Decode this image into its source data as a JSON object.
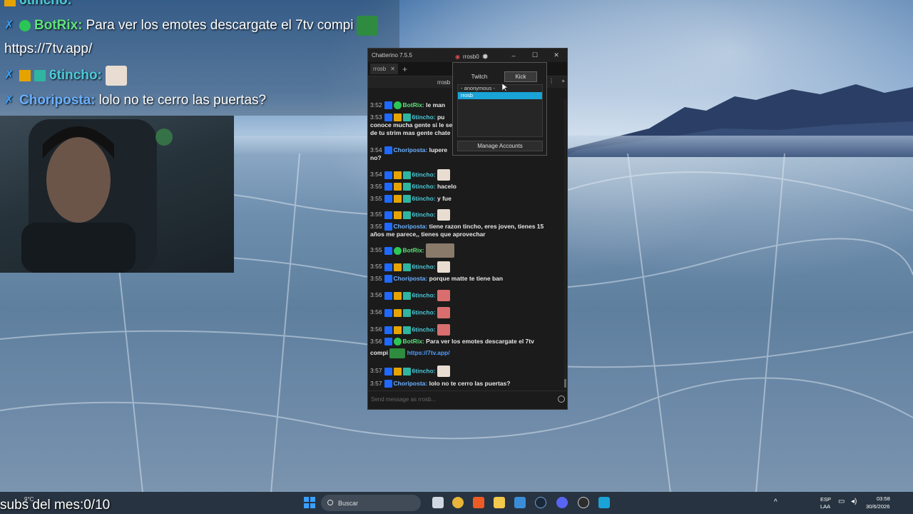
{
  "overlay_chat": {
    "top_partial_user": "6tincho:",
    "lines": [
      {
        "user": "BotRix:",
        "text": "Para ver los emotes descargate el 7tv compi"
      },
      {
        "user": "",
        "text": "https://7tv.app/"
      },
      {
        "user": "6tincho:",
        "text": ""
      },
      {
        "user": "Choriposta:",
        "text": "lolo no te cerro las puertas?"
      }
    ]
  },
  "subs_counter": "subs del mes:0/10",
  "chatterino": {
    "app_title": "Chatterino 7.5.5",
    "current_user": "rrosb0",
    "tab_label": "rrosb",
    "split_name": "rrosb",
    "input_placeholder": "Send message as rrosb...",
    "messages": [
      {
        "time": "3:52",
        "user": "BotRix:",
        "text": "le man"
      },
      {
        "time": "3:53",
        "user": "6tincho:",
        "text": "pu",
        "wrap": "conoce mucha gente si le se",
        "wrap2": "de tu strim mas gente chate"
      },
      {
        "time": "3:54",
        "user": "Choriposta:",
        "text": "lupere",
        "wrap": "no?"
      },
      {
        "time": "3:54",
        "user": "6tincho:",
        "text": ""
      },
      {
        "time": "3:55",
        "user": "6tincho:",
        "text": "hacelo"
      },
      {
        "time": "3:55",
        "user": "6tincho:",
        "text": "y fue"
      },
      {
        "time": "3:55",
        "user": "6tincho:",
        "text": ""
      },
      {
        "time": "3:55",
        "user": "Choriposta:",
        "text": "tiene razon tincho, eres joven, tienes 15",
        "wrap": "años me parece,, tienes que aprovechar"
      },
      {
        "time": "3:55",
        "user": "BotRix:",
        "text": ""
      },
      {
        "time": "3:55",
        "user": "6tincho:",
        "text": ""
      },
      {
        "time": "3:55",
        "user": "Choriposta:",
        "text": "porque matte te tiene ban"
      },
      {
        "time": "3:56",
        "user": "6tincho:",
        "text": ""
      },
      {
        "time": "3:56",
        "user": "6tincho:",
        "text": ""
      },
      {
        "time": "3:56",
        "user": "6tincho:",
        "text": ""
      },
      {
        "time": "3:56",
        "user": "BotRix:",
        "text": "Para ver los emotes descargate el 7tv",
        "wrap": "compi",
        "link": "https://7tv.app/"
      },
      {
        "time": "3:57",
        "user": "6tincho:",
        "text": ""
      },
      {
        "time": "3:57",
        "user": "Choriposta:",
        "text": "lolo no te cerro las puertas?"
      }
    ]
  },
  "account_popup": {
    "tab_twitch": "Twitch",
    "tab_kick": "Kick",
    "accounts": [
      "- anonymous -",
      "rrosb"
    ],
    "selected_index": 1,
    "manage_label": "Manage Accounts"
  },
  "taskbar": {
    "search_label": "Buscar",
    "weather": "9°C",
    "lang_top": "ESP",
    "lang_bottom": "LAA",
    "time": "03:58",
    "date": "30/6/2026"
  },
  "colors": {
    "botrix": "#5fe37b",
    "tincho": "#4cc9d8",
    "choriposta": "#6ab0ff",
    "selection": "#1aa3d6"
  }
}
